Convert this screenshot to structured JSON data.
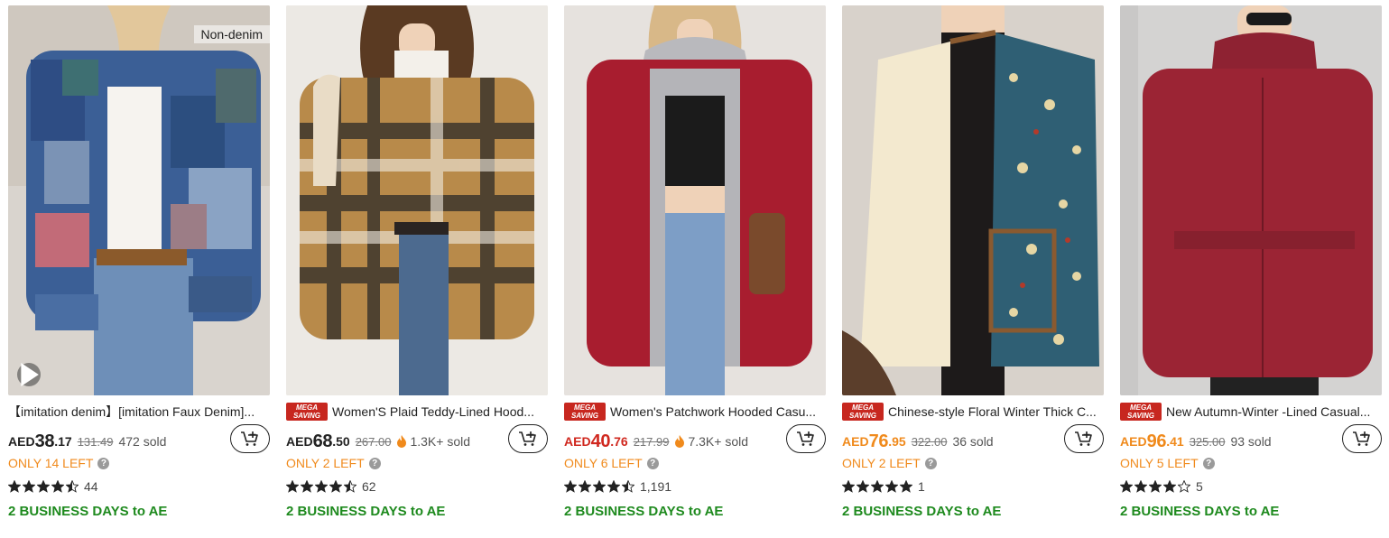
{
  "products": [
    {
      "tag": "Non-denim",
      "mega": false,
      "has_video": true,
      "title": "【imitation denim】[imitation Faux Denim]...",
      "currency": "AED",
      "price_int": "38",
      "price_dec": ".17",
      "price_color": "#222222",
      "original_price": "131.49",
      "hot": false,
      "sold": "472 sold",
      "stock_text": "ONLY 14 LEFT",
      "rating": 4.5,
      "review_count": "44",
      "shipping": "2 BUSINESS DAYS to AE"
    },
    {
      "tag": "",
      "mega": true,
      "has_video": false,
      "title": "Women'S Plaid Teddy-Lined Hood...",
      "currency": "AED",
      "price_int": "68",
      "price_dec": ".50",
      "price_color": "#222222",
      "original_price": "267.00",
      "hot": true,
      "sold": "1.3K+ sold",
      "stock_text": "ONLY 2 LEFT",
      "rating": 4.5,
      "review_count": "62",
      "shipping": "2 BUSINESS DAYS to AE"
    },
    {
      "tag": "",
      "mega": true,
      "has_video": false,
      "title": "Women's Patchwork Hooded Casu...",
      "currency": "AED",
      "price_int": "40",
      "price_dec": ".76",
      "price_color": "#d0281f",
      "original_price": "217.99",
      "hot": true,
      "sold": "7.3K+ sold",
      "stock_text": "ONLY 6 LEFT",
      "rating": 4.5,
      "review_count": "1,191",
      "shipping": "2 BUSINESS DAYS to AE"
    },
    {
      "tag": "",
      "mega": true,
      "has_video": false,
      "title": "Chinese-style Floral Winter Thick C...",
      "currency": "AED",
      "price_int": "76",
      "price_dec": ".95",
      "price_color": "#f08a1c",
      "original_price": "322.00",
      "hot": false,
      "sold": "36 sold",
      "stock_text": "ONLY 2 LEFT",
      "rating": 5,
      "review_count": "1",
      "shipping": "2 BUSINESS DAYS to AE"
    },
    {
      "tag": "",
      "mega": true,
      "has_video": false,
      "title": "New Autumn-Winter -Lined Casual...",
      "currency": "AED",
      "price_int": "96",
      "price_dec": ".41",
      "price_color": "#f08a1c",
      "original_price": "325.00",
      "hot": false,
      "sold": "93 sold",
      "stock_text": "ONLY 5 LEFT",
      "rating": 4,
      "review_count": "5",
      "shipping": "2 BUSINESS DAYS to AE"
    }
  ],
  "mega_label_line1": "MEGA",
  "mega_label_line2": "SAVING",
  "info_glyph": "?",
  "colors": {
    "mega_bg": "#c7271f",
    "stock": "#f08a1c",
    "shipping": "#1e8a1e"
  }
}
